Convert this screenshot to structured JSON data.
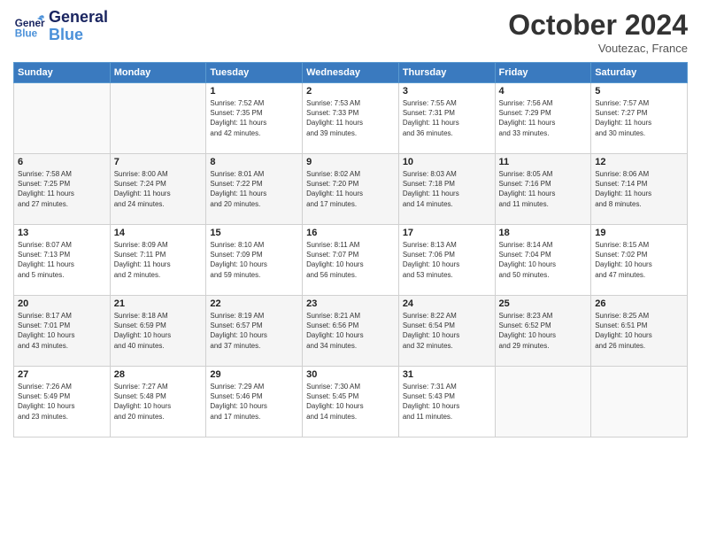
{
  "header": {
    "logo_general": "General",
    "logo_blue": "Blue",
    "month": "October 2024",
    "location": "Voutezac, France"
  },
  "days_of_week": [
    "Sunday",
    "Monday",
    "Tuesday",
    "Wednesday",
    "Thursday",
    "Friday",
    "Saturday"
  ],
  "weeks": [
    [
      {
        "day": "",
        "info": ""
      },
      {
        "day": "",
        "info": ""
      },
      {
        "day": "1",
        "info": "Sunrise: 7:52 AM\nSunset: 7:35 PM\nDaylight: 11 hours\nand 42 minutes."
      },
      {
        "day": "2",
        "info": "Sunrise: 7:53 AM\nSunset: 7:33 PM\nDaylight: 11 hours\nand 39 minutes."
      },
      {
        "day": "3",
        "info": "Sunrise: 7:55 AM\nSunset: 7:31 PM\nDaylight: 11 hours\nand 36 minutes."
      },
      {
        "day": "4",
        "info": "Sunrise: 7:56 AM\nSunset: 7:29 PM\nDaylight: 11 hours\nand 33 minutes."
      },
      {
        "day": "5",
        "info": "Sunrise: 7:57 AM\nSunset: 7:27 PM\nDaylight: 11 hours\nand 30 minutes."
      }
    ],
    [
      {
        "day": "6",
        "info": "Sunrise: 7:58 AM\nSunset: 7:25 PM\nDaylight: 11 hours\nand 27 minutes."
      },
      {
        "day": "7",
        "info": "Sunrise: 8:00 AM\nSunset: 7:24 PM\nDaylight: 11 hours\nand 24 minutes."
      },
      {
        "day": "8",
        "info": "Sunrise: 8:01 AM\nSunset: 7:22 PM\nDaylight: 11 hours\nand 20 minutes."
      },
      {
        "day": "9",
        "info": "Sunrise: 8:02 AM\nSunset: 7:20 PM\nDaylight: 11 hours\nand 17 minutes."
      },
      {
        "day": "10",
        "info": "Sunrise: 8:03 AM\nSunset: 7:18 PM\nDaylight: 11 hours\nand 14 minutes."
      },
      {
        "day": "11",
        "info": "Sunrise: 8:05 AM\nSunset: 7:16 PM\nDaylight: 11 hours\nand 11 minutes."
      },
      {
        "day": "12",
        "info": "Sunrise: 8:06 AM\nSunset: 7:14 PM\nDaylight: 11 hours\nand 8 minutes."
      }
    ],
    [
      {
        "day": "13",
        "info": "Sunrise: 8:07 AM\nSunset: 7:13 PM\nDaylight: 11 hours\nand 5 minutes."
      },
      {
        "day": "14",
        "info": "Sunrise: 8:09 AM\nSunset: 7:11 PM\nDaylight: 11 hours\nand 2 minutes."
      },
      {
        "day": "15",
        "info": "Sunrise: 8:10 AM\nSunset: 7:09 PM\nDaylight: 10 hours\nand 59 minutes."
      },
      {
        "day": "16",
        "info": "Sunrise: 8:11 AM\nSunset: 7:07 PM\nDaylight: 10 hours\nand 56 minutes."
      },
      {
        "day": "17",
        "info": "Sunrise: 8:13 AM\nSunset: 7:06 PM\nDaylight: 10 hours\nand 53 minutes."
      },
      {
        "day": "18",
        "info": "Sunrise: 8:14 AM\nSunset: 7:04 PM\nDaylight: 10 hours\nand 50 minutes."
      },
      {
        "day": "19",
        "info": "Sunrise: 8:15 AM\nSunset: 7:02 PM\nDaylight: 10 hours\nand 47 minutes."
      }
    ],
    [
      {
        "day": "20",
        "info": "Sunrise: 8:17 AM\nSunset: 7:01 PM\nDaylight: 10 hours\nand 43 minutes."
      },
      {
        "day": "21",
        "info": "Sunrise: 8:18 AM\nSunset: 6:59 PM\nDaylight: 10 hours\nand 40 minutes."
      },
      {
        "day": "22",
        "info": "Sunrise: 8:19 AM\nSunset: 6:57 PM\nDaylight: 10 hours\nand 37 minutes."
      },
      {
        "day": "23",
        "info": "Sunrise: 8:21 AM\nSunset: 6:56 PM\nDaylight: 10 hours\nand 34 minutes."
      },
      {
        "day": "24",
        "info": "Sunrise: 8:22 AM\nSunset: 6:54 PM\nDaylight: 10 hours\nand 32 minutes."
      },
      {
        "day": "25",
        "info": "Sunrise: 8:23 AM\nSunset: 6:52 PM\nDaylight: 10 hours\nand 29 minutes."
      },
      {
        "day": "26",
        "info": "Sunrise: 8:25 AM\nSunset: 6:51 PM\nDaylight: 10 hours\nand 26 minutes."
      }
    ],
    [
      {
        "day": "27",
        "info": "Sunrise: 7:26 AM\nSunset: 5:49 PM\nDaylight: 10 hours\nand 23 minutes."
      },
      {
        "day": "28",
        "info": "Sunrise: 7:27 AM\nSunset: 5:48 PM\nDaylight: 10 hours\nand 20 minutes."
      },
      {
        "day": "29",
        "info": "Sunrise: 7:29 AM\nSunset: 5:46 PM\nDaylight: 10 hours\nand 17 minutes."
      },
      {
        "day": "30",
        "info": "Sunrise: 7:30 AM\nSunset: 5:45 PM\nDaylight: 10 hours\nand 14 minutes."
      },
      {
        "day": "31",
        "info": "Sunrise: 7:31 AM\nSunset: 5:43 PM\nDaylight: 10 hours\nand 11 minutes."
      },
      {
        "day": "",
        "info": ""
      },
      {
        "day": "",
        "info": ""
      }
    ]
  ]
}
